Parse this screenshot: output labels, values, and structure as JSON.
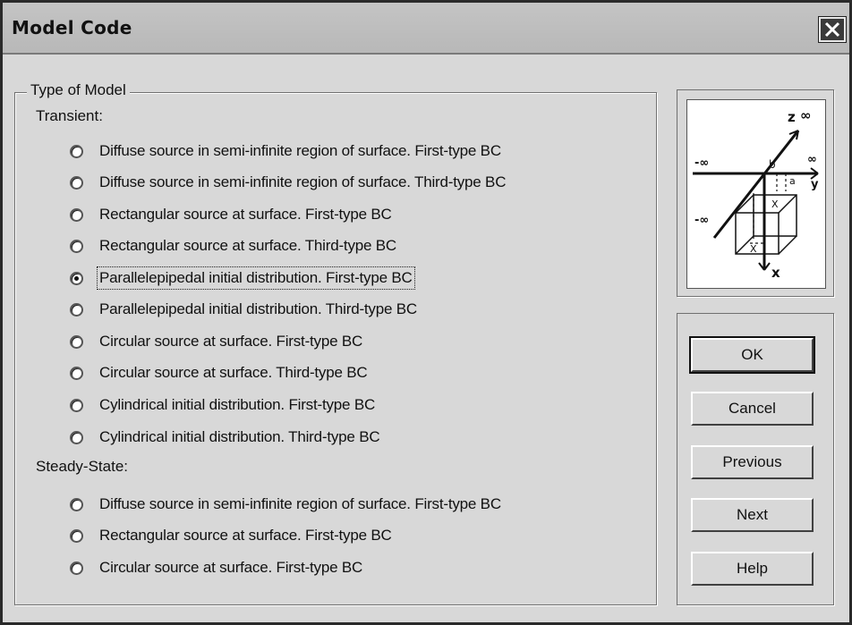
{
  "window": {
    "title": "Model Code"
  },
  "group": {
    "legend": "Type of Model",
    "transient_label": "Transient:",
    "steady_label": "Steady-State:",
    "transient": [
      {
        "label": "Diffuse source in semi-infinite region of surface. First-type BC",
        "checked": false
      },
      {
        "label": "Diffuse source in semi-infinite region of surface. Third-type BC",
        "checked": false
      },
      {
        "label": "Rectangular source at surface. First-type BC",
        "checked": false
      },
      {
        "label": "Rectangular source at surface. Third-type BC",
        "checked": false
      },
      {
        "label": "Parallelepipedal initial distribution. First-type BC",
        "checked": true
      },
      {
        "label": "Parallelepipedal initial distribution. Third-type BC",
        "checked": false
      },
      {
        "label": "Circular source at surface. First-type BC",
        "checked": false
      },
      {
        "label": "Circular source at surface. Third-type BC",
        "checked": false
      },
      {
        "label": "Cylindrical initial distribution. First-type BC",
        "checked": false
      },
      {
        "label": "Cylindrical initial distribution. Third-type BC",
        "checked": false
      }
    ],
    "steady": [
      {
        "label": "Diffuse source in semi-infinite region of surface. First-type BC",
        "checked": false
      },
      {
        "label": "Rectangular source at surface. First-type BC",
        "checked": false
      },
      {
        "label": "Circular source at surface. First-type BC",
        "checked": false
      }
    ]
  },
  "diagram": {
    "z_label": "z",
    "y_label": "y",
    "x_label": "x",
    "inf_label": "∞",
    "neg_inf_label": "-∞",
    "a_label": "a",
    "b_label": "b",
    "x1_label": "X",
    "x2_label": "X"
  },
  "buttons": {
    "ok": "OK",
    "cancel": "Cancel",
    "previous": "Previous",
    "next": "Next",
    "help": "Help"
  }
}
